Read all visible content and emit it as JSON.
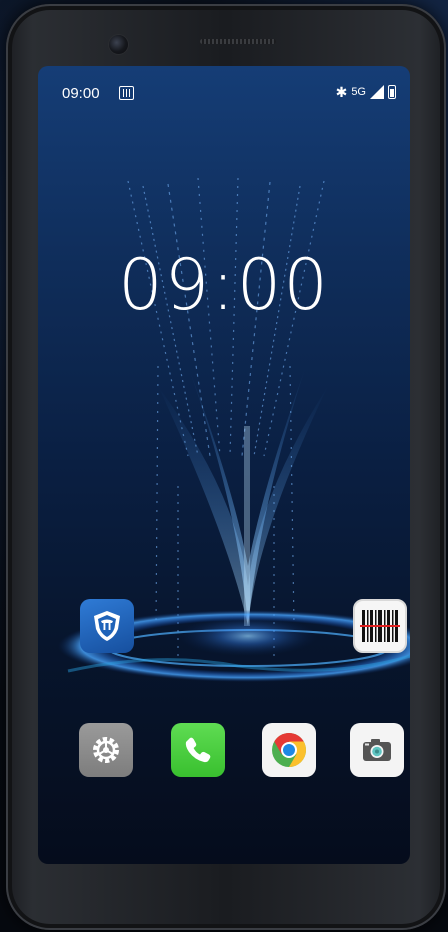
{
  "status_bar": {
    "time": "09:00",
    "sim_icon": "sim-card-icon",
    "bluetooth_icon": "bluetooth-icon",
    "network": "5G",
    "signal_icon": "signal-icon",
    "battery_icon": "battery-icon"
  },
  "lock_clock": {
    "time": "09:00"
  },
  "apps": {
    "row_top": [
      {
        "name": "security-app",
        "icon": "shield-icon"
      },
      {
        "name": "barcode-scanner-app",
        "icon": "barcode-icon"
      }
    ],
    "dock": [
      {
        "name": "settings-app",
        "icon": "gear-icon"
      },
      {
        "name": "phone-app",
        "icon": "phone-icon"
      },
      {
        "name": "chrome-app",
        "icon": "chrome-icon"
      },
      {
        "name": "camera-app",
        "icon": "camera-icon"
      }
    ]
  },
  "colors": {
    "phone_app": "#4cd142",
    "security_app": "#1f63b9",
    "settings_app": "#8c8c8c",
    "wallpaper_top": "#153d76",
    "wallpaper_bottom": "#050c1c"
  }
}
